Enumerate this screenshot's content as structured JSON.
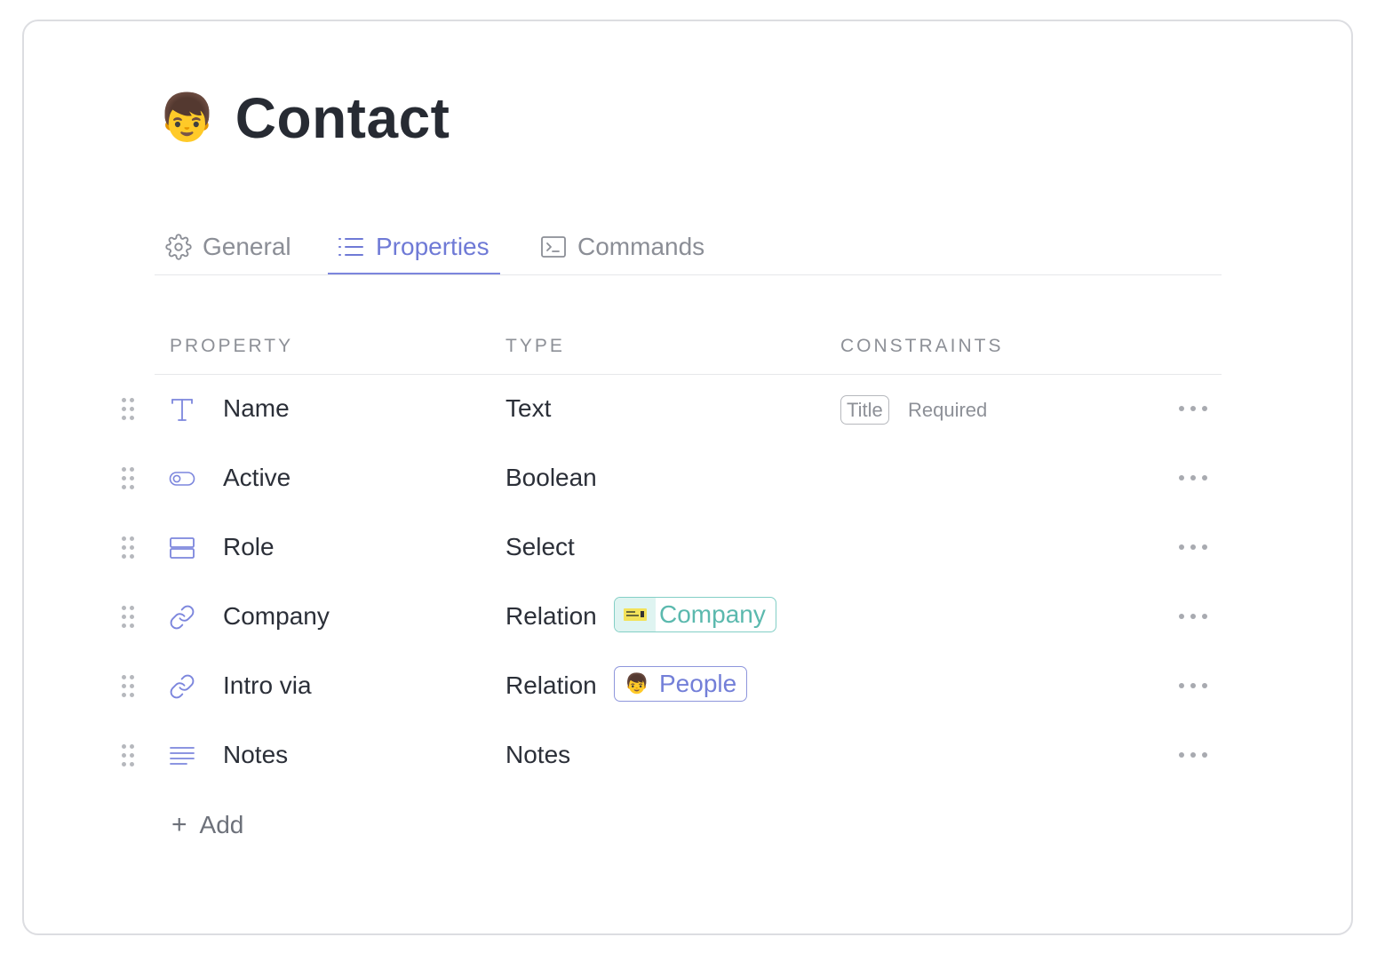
{
  "page": {
    "title": "Contact",
    "icon": "person-emoji",
    "emoji": "👦"
  },
  "tabs": [
    {
      "label": "General",
      "icon": "gear-icon",
      "active": false
    },
    {
      "label": "Properties",
      "icon": "list-icon",
      "active": true
    },
    {
      "label": "Commands",
      "icon": "terminal-icon",
      "active": false
    }
  ],
  "table": {
    "headers": {
      "property": "Property",
      "type": "Type",
      "constraints": "Constraints"
    },
    "rows": [
      {
        "name": "Name",
        "icon": "text-icon",
        "type": "Text",
        "badge": "Title",
        "constraint": "Required"
      },
      {
        "name": "Active",
        "icon": "toggle-icon",
        "type": "Boolean"
      },
      {
        "name": "Role",
        "icon": "select-icon",
        "type": "Select"
      },
      {
        "name": "Company",
        "icon": "link-icon",
        "type": "Relation",
        "relation": "Company",
        "relation_icon": "company-card-icon"
      },
      {
        "name": "Intro via",
        "icon": "link-icon",
        "type": "Relation",
        "relation": "People",
        "relation_icon": "person-emoji",
        "relation_emoji": "👦"
      },
      {
        "name": "Notes",
        "icon": "notes-icon",
        "type": "Notes"
      }
    ]
  },
  "add_label": "Add",
  "add_symbol": "+",
  "colors": {
    "accent": "#6f7ad6",
    "company_chip": "#5bb9ae",
    "muted": "#8d9097",
    "text": "#2b2f38"
  }
}
